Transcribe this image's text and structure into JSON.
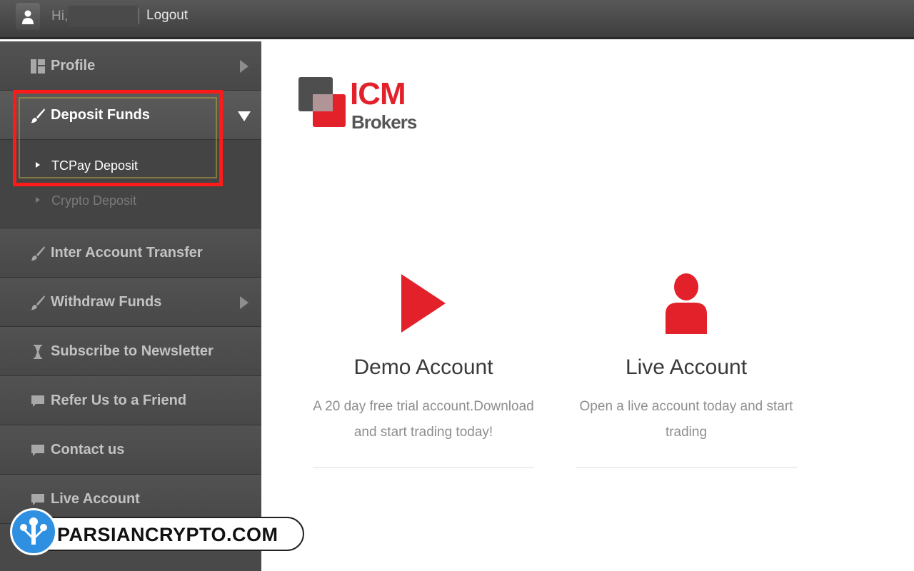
{
  "topbar": {
    "greeting": "Hi,",
    "logout_label": "Logout"
  },
  "sidebar": {
    "items": [
      {
        "label": "Profile",
        "icon": "dashboard-icon"
      },
      {
        "label": "Deposit Funds",
        "icon": "brush-icon"
      },
      {
        "label": "Inter Account Transfer",
        "icon": "brush-icon"
      },
      {
        "label": "Withdraw Funds",
        "icon": "brush-icon"
      },
      {
        "label": "Subscribe to Newsletter",
        "icon": "hourglass-icon"
      },
      {
        "label": "Refer Us to a Friend",
        "icon": "chat-icon"
      },
      {
        "label": "Contact us",
        "icon": "chat-icon"
      },
      {
        "label": "Live Account",
        "icon": "chat-icon"
      }
    ],
    "submenu": [
      {
        "label": "TCPay Deposit"
      },
      {
        "label": "Crypto Deposit"
      }
    ]
  },
  "logo": {
    "line1": "ICM",
    "line2": "Brokers"
  },
  "cards": [
    {
      "title": "Demo Account",
      "desc_line1": "A 20 day free trial account.Download",
      "desc_line2": "and start trading today!",
      "icon": "play-icon"
    },
    {
      "title": "Live Account",
      "desc_line1": "Open a live account today and start",
      "desc_line2": "trading",
      "icon": "user-icon"
    }
  ],
  "watermark": {
    "text": "PARSIANCRYPTO.COM"
  },
  "colors": {
    "accent": "#e3212b",
    "sidebar": "#494949",
    "highlight": "#ff1a1a"
  }
}
